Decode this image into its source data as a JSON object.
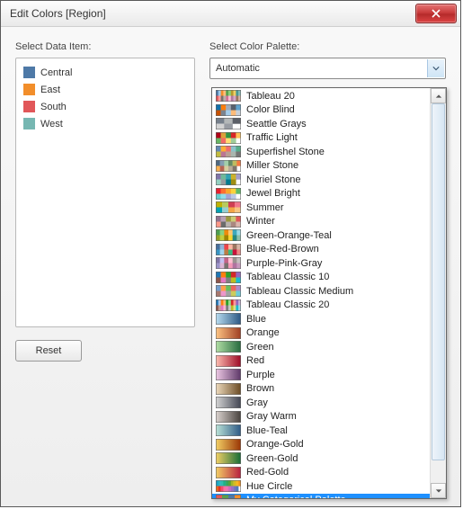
{
  "window": {
    "title": "Edit Colors [Region]"
  },
  "left": {
    "label": "Select Data Item:",
    "items": [
      {
        "label": "Central",
        "color": "#4e79a7"
      },
      {
        "label": "East",
        "color": "#f28e2b"
      },
      {
        "label": "South",
        "color": "#e15759"
      },
      {
        "label": "West",
        "color": "#76b7b2"
      }
    ]
  },
  "right": {
    "label": "Select Color Palette:",
    "selected": "Automatic"
  },
  "reset_label": "Reset",
  "palettes": [
    {
      "label": "Tableau 20",
      "type": "cat",
      "colors": [
        "#4e79a7",
        "#a0cbe8",
        "#f28e2b",
        "#ffbe7d",
        "#59a14f",
        "#8cd17d",
        "#b6992d",
        "#f1ce63",
        "#499894",
        "#86bcb6",
        "#e15759",
        "#ff9d9a",
        "#79706e",
        "#bab0ac",
        "#d37295",
        "#fabfd2",
        "#b07aa1",
        "#d4a6c8",
        "#9d7660",
        "#d7b5a6"
      ]
    },
    {
      "label": "Color Blind",
      "type": "cat",
      "colors": [
        "#1170aa",
        "#fc7d0b",
        "#a3acb9",
        "#57606c",
        "#5fa2ce",
        "#c85200",
        "#7b848f",
        "#a3cce9",
        "#ffbc79",
        "#c8d0d9"
      ]
    },
    {
      "label": "Seattle Grays",
      "type": "cat",
      "colors": [
        "#767f8b",
        "#b3b7b8",
        "#5c6068",
        "#d3d3d3",
        "#989ca3"
      ]
    },
    {
      "label": "Traffic Light",
      "type": "cat",
      "colors": [
        "#b10318",
        "#dba13a",
        "#309343",
        "#d82526",
        "#ffc156",
        "#69b764",
        "#f26c64",
        "#ffdd71",
        "#9fcd99"
      ]
    },
    {
      "label": "Superfishel Stone",
      "type": "cat",
      "colors": [
        "#6388b4",
        "#ffae34",
        "#ef6f6a",
        "#8cc2ca",
        "#55ad89",
        "#c3bc3f",
        "#bb7693",
        "#baa094",
        "#a9b5ae",
        "#767676"
      ]
    },
    {
      "label": "Miller Stone",
      "type": "cat",
      "colors": [
        "#4f6980",
        "#849db1",
        "#a2ceaa",
        "#638b66",
        "#bfbb60",
        "#f47942",
        "#fbb04e",
        "#b66353",
        "#d7ce9f",
        "#b9aa97",
        "#7e756d"
      ]
    },
    {
      "label": "Nuriel Stone",
      "type": "cat",
      "colors": [
        "#8175aa",
        "#6fb899",
        "#31a1b3",
        "#ccb22b",
        "#a39fc9",
        "#94d0c0",
        "#959c9e",
        "#027b8e",
        "#9f8f12"
      ]
    },
    {
      "label": "Jewel Bright",
      "type": "cat",
      "colors": [
        "#eb1e2c",
        "#fd6f30",
        "#f9a729",
        "#f9d23c",
        "#5fbb68",
        "#64cdcc",
        "#91dcea",
        "#a4a4d5",
        "#bbc9e5"
      ]
    },
    {
      "label": "Summer",
      "type": "cat",
      "colors": [
        "#bfb202",
        "#b9ca5d",
        "#cf3e53",
        "#f1788d",
        "#00a2b3",
        "#97cfd0",
        "#f3a546",
        "#f7c480"
      ]
    },
    {
      "label": "Winter",
      "type": "cat",
      "colors": [
        "#90728f",
        "#b9a0b4",
        "#9d983d",
        "#cecb76",
        "#e15759",
        "#ff9888",
        "#6b6b6b",
        "#bab2ae",
        "#aa8780",
        "#dab6af"
      ]
    },
    {
      "label": "Green-Orange-Teal",
      "type": "cat",
      "colors": [
        "#4e9f50",
        "#87d180",
        "#ef8a0c",
        "#fcc66d",
        "#3ca8bc",
        "#98d9e4",
        "#94a323",
        "#c3ce3d",
        "#a08400",
        "#f7d42a",
        "#26897e",
        "#8dbfa8"
      ]
    },
    {
      "label": "Blue-Red-Brown",
      "type": "cat",
      "colors": [
        "#466f9d",
        "#91b3d7",
        "#ed444a",
        "#feb5a2",
        "#9d7660",
        "#d7b5a6",
        "#3896c4",
        "#a0d4ee",
        "#ba7e45",
        "#39b87f",
        "#c8133b",
        "#ea8783"
      ]
    },
    {
      "label": "Purple-Pink-Gray",
      "type": "cat",
      "colors": [
        "#8074a8",
        "#c6c1f0",
        "#c46487",
        "#ffbed1",
        "#9c9290",
        "#c5bfbe",
        "#9b93c9",
        "#ddb5d5",
        "#7c7270",
        "#f498b6",
        "#b173a0",
        "#c799bc"
      ]
    },
    {
      "label": "Tableau Classic 10",
      "type": "cat",
      "colors": [
        "#1f77b4",
        "#ff7f0e",
        "#2ca02c",
        "#d62728",
        "#9467bd",
        "#8c564b",
        "#e377c2",
        "#7f7f7f",
        "#bcbd22",
        "#17becf"
      ]
    },
    {
      "label": "Tableau Classic Medium",
      "type": "cat",
      "colors": [
        "#729ece",
        "#ff9e4a",
        "#67bf5c",
        "#ed665d",
        "#ad8bc9",
        "#a8786e",
        "#ed97ca",
        "#a2a2a2",
        "#cdcc5d",
        "#6dccda"
      ]
    },
    {
      "label": "Tableau Classic 20",
      "type": "cat",
      "colors": [
        "#1f77b4",
        "#aec7e8",
        "#ff7f0e",
        "#ffbb78",
        "#2ca02c",
        "#98df8a",
        "#d62728",
        "#ff9896",
        "#9467bd",
        "#c5b0d5",
        "#8c564b",
        "#c49c94",
        "#e377c2",
        "#f7b6d2",
        "#7f7f7f",
        "#c7c7c7",
        "#bcbd22",
        "#dbdb8d",
        "#17becf",
        "#9edae5"
      ]
    },
    {
      "label": "Blue",
      "type": "grad",
      "stops": [
        "#b9ddf1",
        "#2a5783"
      ]
    },
    {
      "label": "Orange",
      "type": "grad",
      "stops": [
        "#ffc685",
        "#9e3d22"
      ]
    },
    {
      "label": "Green",
      "type": "grad",
      "stops": [
        "#b3e0a6",
        "#24693d"
      ]
    },
    {
      "label": "Red",
      "type": "grad",
      "stops": [
        "#ffbeb2",
        "#9c0824"
      ]
    },
    {
      "label": "Purple",
      "type": "grad",
      "stops": [
        "#eec9e5",
        "#5c3667"
      ]
    },
    {
      "label": "Brown",
      "type": "grad",
      "stops": [
        "#eedbbd",
        "#6a4a23"
      ]
    },
    {
      "label": "Gray",
      "type": "grad",
      "stops": [
        "#d5d5d5",
        "#414451"
      ]
    },
    {
      "label": "Gray Warm",
      "type": "grad",
      "stops": [
        "#dcd4d0",
        "#46403c"
      ]
    },
    {
      "label": "Blue-Teal",
      "type": "grad",
      "stops": [
        "#bce4d8",
        "#2c5985"
      ]
    },
    {
      "label": "Orange-Gold",
      "type": "grad",
      "stops": [
        "#f4d166",
        "#993404"
      ]
    },
    {
      "label": "Green-Gold",
      "type": "grad",
      "stops": [
        "#f4d166",
        "#146c36"
      ]
    },
    {
      "label": "Red-Gold",
      "type": "grad",
      "stops": [
        "#f4d166",
        "#b71d3e"
      ]
    },
    {
      "label": "Hue Circle",
      "type": "cat",
      "colors": [
        "#1ba3c6",
        "#2cb5c0",
        "#30bcad",
        "#21B087",
        "#33a65c",
        "#57a337",
        "#a2b627",
        "#d5bb21",
        "#f8b620",
        "#f89217",
        "#f06719",
        "#e03426",
        "#f64971",
        "#fc719e",
        "#eb73b3",
        "#ce69be",
        "#a26dc2",
        "#7873c0",
        "#4f7cba"
      ]
    },
    {
      "label": "My Categorical Palette",
      "type": "cat",
      "selected": true,
      "colors": [
        "#e15759",
        "#59a14f",
        "#4e79a7",
        "#f28e2b",
        "#b07aa1",
        "#76b7b2",
        "#ff9da7",
        "#edc948"
      ]
    }
  ]
}
